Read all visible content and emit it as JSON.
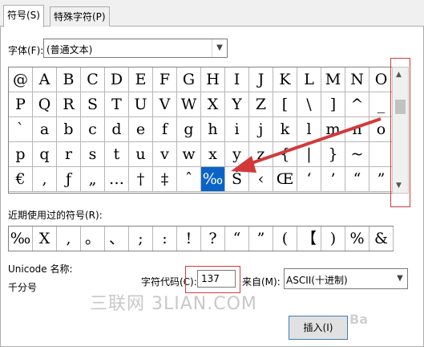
{
  "tabs": [
    "符号(S)",
    "特殊字符(P)"
  ],
  "font": {
    "label": "字体(F):",
    "value": "(普通文本)"
  },
  "grid": {
    "rows": [
      [
        "@",
        "A",
        "B",
        "C",
        "D",
        "E",
        "F",
        "G",
        "H",
        "I",
        "J",
        "K",
        "L",
        "M",
        "N",
        "O"
      ],
      [
        "P",
        "Q",
        "R",
        "S",
        "T",
        "U",
        "V",
        "W",
        "X",
        "Y",
        "Z",
        "[",
        "\\",
        "]",
        "^",
        "_"
      ],
      [
        "`",
        "a",
        "b",
        "c",
        "d",
        "e",
        "f",
        "g",
        "h",
        "i",
        "j",
        "k",
        "l",
        "m",
        "n",
        "o"
      ],
      [
        "p",
        "q",
        "r",
        "s",
        "t",
        "u",
        "v",
        "w",
        "x",
        "y",
        "z",
        "{",
        "|",
        "}",
        "~",
        ""
      ],
      [
        "€",
        ",",
        "ƒ",
        "„",
        "…",
        "†",
        "‡",
        "ˆ",
        "‰",
        "Š",
        "‹",
        "Œ",
        "‘",
        "’",
        "“",
        "”"
      ]
    ],
    "selected": "‰"
  },
  "recent": {
    "label": "近期使用过的符号(R):",
    "items": [
      "‰",
      "X",
      ",",
      "。",
      "、",
      ";",
      ":",
      "!",
      "?",
      "“",
      "”",
      "(",
      "【",
      ")",
      "%",
      "&"
    ]
  },
  "unicode_name": {
    "label": "Unicode 名称:",
    "value": "千分号"
  },
  "char_code": {
    "label": "字符代码(C):",
    "value": "137"
  },
  "from": {
    "label": "来自(M):",
    "value": "ASCII(十进制)"
  },
  "watermark": "三联网 3LIAN.COM",
  "insert_button": "插入(I)",
  "baidu_mark": "Ba",
  "colors": {
    "selection": "#0a64c8",
    "annotation": "#d23a3a"
  }
}
